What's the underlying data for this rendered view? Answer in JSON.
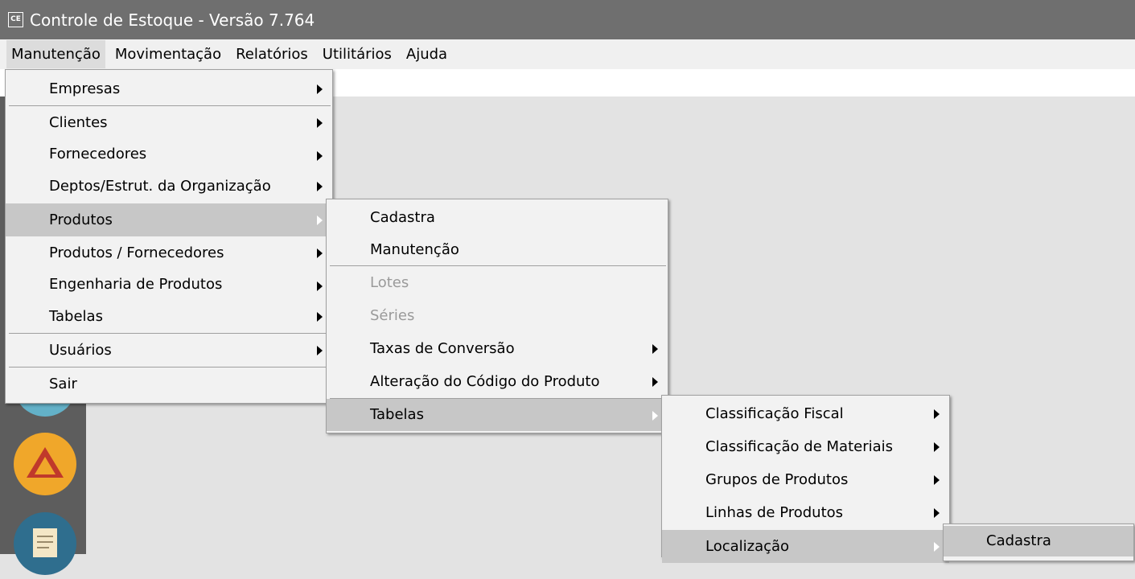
{
  "window": {
    "icon_label": "CE",
    "title": "Controle de Estoque - Versão 7.764"
  },
  "menubar": [
    "Manutenção",
    "Movimentação",
    "Relatórios",
    "Utilitários",
    "Ajuda"
  ],
  "menu_manutencao": {
    "empresas": "Empresas",
    "clientes": "Clientes",
    "fornecedores": "Fornecedores",
    "deptos": "Deptos/Estrut. da Organização",
    "produtos": "Produtos",
    "produtos_fornecedores": "Produtos / Fornecedores",
    "engenharia": "Engenharia de Produtos",
    "tabelas": "Tabelas",
    "usuarios": "Usuários",
    "sair": "Sair"
  },
  "menu_produtos": {
    "cadastra": "Cadastra",
    "manutencao": "Manutenção",
    "lotes": "Lotes",
    "series": "Séries",
    "taxas": "Taxas de Conversão",
    "alteracao": "Alteração do Código do Produto",
    "tabelas": "Tabelas"
  },
  "menu_tabelas": {
    "classificacao_fiscal": "Classificação Fiscal",
    "classificacao_materiais": "Classificação de Materiais",
    "grupos": "Grupos de Produtos",
    "linhas": "Linhas de Produtos",
    "localizacao": "Localização"
  },
  "menu_localizacao": {
    "cadastra": "Cadastra"
  },
  "colors": {
    "titlebar": "#6f6f6f",
    "menu_bg": "#f2f2f2",
    "highlight": "#c7c7c7",
    "workspace": "#e3e3e3",
    "sidebar": "#5d5d5d"
  }
}
